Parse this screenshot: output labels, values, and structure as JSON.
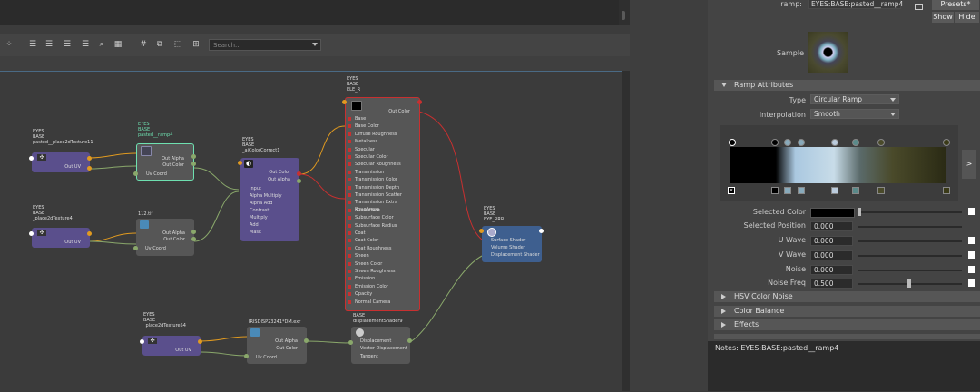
{
  "editor": {
    "search_placeholder": "Search...",
    "nodes": [
      {
        "id": "place2dTexture11",
        "lines": [
          "EYES",
          "BASE",
          "pasted__place2dTexture11"
        ],
        "ports": [
          "Out UV"
        ]
      },
      {
        "id": "ramp4",
        "lines": [
          "EYES",
          "BASE",
          "pasted__ramp4"
        ],
        "ports": [
          "Out Alpha",
          "Out Color",
          "Uv Coord"
        ]
      },
      {
        "id": "place2dTexture4",
        "lines": [
          "EYES",
          "BASE",
          "_place2dTexture4"
        ],
        "ports": [
          "Out UV"
        ]
      },
      {
        "id": "file112",
        "lines": [
          "112.tif"
        ],
        "ports": [
          "Out Alpha",
          "Out Color",
          "Uv Coord"
        ]
      },
      {
        "id": "colorCorrect",
        "lines": [
          "EYES",
          "BASE",
          "_aiColorCorrect1"
        ],
        "ports": [
          "Out Color",
          "Out Alpha",
          "Input",
          "Alpha Multiply",
          "Alpha Add",
          "Contrast",
          "Multiply",
          "Add",
          "Mask"
        ]
      },
      {
        "id": "eleR",
        "lines": [
          "EYES",
          "BASE",
          "ELE_R"
        ],
        "ports": [
          "Out Color",
          "Base",
          "Base Color",
          "Diffuse Roughness",
          "Metalness",
          "Specular",
          "Specular Color",
          "Specular Roughness",
          "Transmission",
          "Transmission Color",
          "Transmission Depth",
          "Transmission Scatter",
          "Transmission Extra Roughness",
          "Subsurface",
          "Subsurface Color",
          "Subsurface Radius",
          "Coat",
          "Coat Color",
          "Coat Roughness",
          "Sheen",
          "Sheen Color",
          "Sheen Roughness",
          "Emission",
          "Emission Color",
          "Opacity",
          "Normal Camera"
        ]
      },
      {
        "id": "eyeRRR",
        "lines": [
          "EYES",
          "BASE",
          "EYE_RRR"
        ],
        "ports": [
          "Surface Shader",
          "Volume Shader",
          "Displacement Shader"
        ]
      },
      {
        "id": "place2dTexture54",
        "lines": [
          "EYES",
          "BASE",
          "_place2dTexture54"
        ],
        "ports": [
          "Out UV"
        ]
      },
      {
        "id": "irisDisp",
        "lines": [
          "IRISDISP23241*DM.exr"
        ],
        "ports": [
          "Out Alpha",
          "Out Color",
          "Uv Coord"
        ]
      },
      {
        "id": "dispShader",
        "lines": [
          "BASE",
          "displacementShader9"
        ],
        "ports": [
          "Displacement",
          "Vector Displacement",
          "Tangent"
        ]
      }
    ]
  },
  "attr": {
    "ramp_label": "ramp:",
    "ramp_name": "EYES:BASE:pasted__ramp4",
    "presets_label": "Presets*",
    "show_label": "Show",
    "hide_label": "Hide",
    "sample_label": "Sample",
    "ramp_section": "Ramp Attributes",
    "type_label": "Type",
    "type_value": "Circular Ramp",
    "interp_label": "Interpolation",
    "interp_value": "Smooth",
    "selected_color_label": "Selected Color",
    "selected_position_label": "Selected Position",
    "selected_position_value": "0.000",
    "u_wave_label": "U Wave",
    "u_wave_value": "0.000",
    "v_wave_label": "V Wave",
    "v_wave_value": "0.000",
    "noise_label": "Noise",
    "noise_value": "0.000",
    "noise_freq_label": "Noise Freq",
    "noise_freq_value": "0.500",
    "sections": [
      "HSV Color Noise",
      "Color Balance",
      "Effects"
    ],
    "notes_label": "Notes:",
    "notes_value": "EYES:BASE:pasted__ramp4",
    "expand_label": ">"
  },
  "colors": {
    "ramp_gradient": [
      "#000000",
      "#000000",
      "#aac8e0",
      "#c8dce8",
      "#5a6a6a",
      "#4a4a2a",
      "#2a2a14"
    ],
    "selection_border": "#c83030",
    "selected_node_border": "#6ee0b0"
  }
}
